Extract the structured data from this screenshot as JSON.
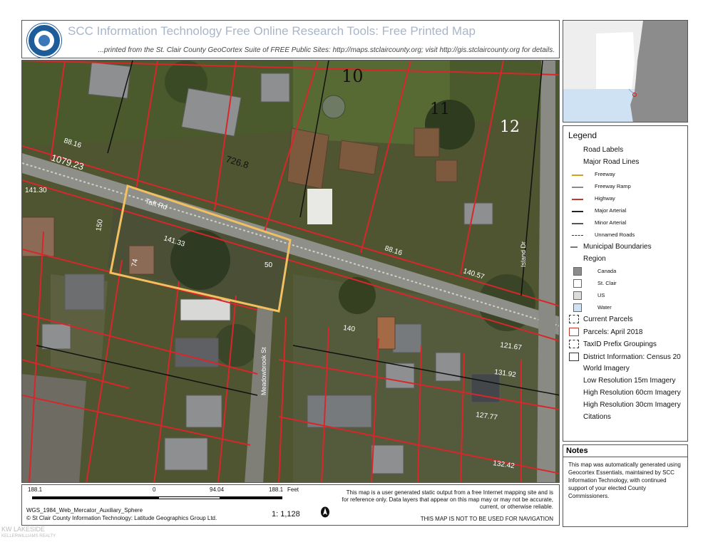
{
  "header": {
    "title": "SCC Information Technology Free Online Research Tools: Free Printed Map",
    "subtitle": "...printed from the St. Clair County GeoCortex Suite of FREE Public Sites: http://maps.stclaircounty.org; visit http://gis.stclaircounty.org for details."
  },
  "map": {
    "road_labels": [
      "Taft Rd",
      "Meadowbrook St",
      "Island Dr"
    ],
    "lot_numbers": [
      "10",
      "11",
      "12"
    ],
    "dimensions": [
      "88.16",
      "1079.23",
      "726.8",
      "141.30",
      "141.33",
      "88.16",
      "140.57",
      "140",
      "121.67",
      "131.92",
      "127.77",
      "132.42",
      "150",
      "74",
      "50"
    ]
  },
  "legend": {
    "title": "Legend",
    "items": [
      {
        "label": "Road Labels",
        "symbol": "none"
      },
      {
        "label": "Major Road Lines",
        "symbol": "none"
      },
      {
        "label": "Freeway",
        "symbol": "line",
        "color": "#d4a017",
        "sub": true
      },
      {
        "label": "Freeway Ramp",
        "symbol": "line",
        "color": "#8a8a8a",
        "sub": true
      },
      {
        "label": "Highway",
        "symbol": "line",
        "color": "#c0392b",
        "sub": true
      },
      {
        "label": "Major Arterial",
        "symbol": "line",
        "color": "#222222",
        "sub": true
      },
      {
        "label": "Minor Arterial",
        "symbol": "line",
        "color": "#555555",
        "sub": true
      },
      {
        "label": "Unnamed Roads",
        "symbol": "dash",
        "color": "#333333",
        "sub": true
      },
      {
        "label": "Municipal Boundaries",
        "symbol": "line",
        "color": "#777777"
      },
      {
        "label": "Region",
        "symbol": "none"
      },
      {
        "label": "Canada",
        "symbol": "box",
        "color": "#8c8c8c",
        "sub": true
      },
      {
        "label": "St. Clair",
        "symbol": "box",
        "color": "#ffffff",
        "sub": true
      },
      {
        "label": "US",
        "symbol": "box",
        "color": "#dcdcdc",
        "sub": true
      },
      {
        "label": "Water",
        "symbol": "box",
        "color": "#cfe2f3",
        "sub": true
      },
      {
        "label": "Current Parcels",
        "symbol": "dashbox",
        "color": "#333333"
      },
      {
        "label": "Parcels: April 2018",
        "symbol": "box",
        "color": "#ffffff",
        "border": "#c0392b"
      },
      {
        "label": "TaxID Prefix Groupings",
        "symbol": "dashbox",
        "color": "#333333"
      },
      {
        "label": "District Information: Census 20",
        "symbol": "box",
        "color": "#ffffff",
        "border": "#333333"
      },
      {
        "label": "World Imagery",
        "symbol": "none"
      },
      {
        "label": "Low Resolution 15m Imagery",
        "symbol": "none"
      },
      {
        "label": "High Resolution 60cm Imagery",
        "symbol": "none"
      },
      {
        "label": "High Resolution 30cm Imagery",
        "symbol": "none"
      },
      {
        "label": "Citations",
        "symbol": "none"
      }
    ]
  },
  "notes": {
    "title": "Notes",
    "body": "This map was automatically generated using Geocortex Essentials, maintained by SCC Information Technology, with continued support of your elected County Commissioners."
  },
  "footer": {
    "scale_labels": [
      "188.1",
      "0",
      "94.04",
      "188.1",
      "Feet"
    ],
    "projection": "WGS_1984_Web_Mercator_Auxiliary_Sphere",
    "credit": "© St Clair County Information Technology: Latitude Geographics Group Ltd.",
    "ratio": "1: 1,128",
    "disclaimer": "This map is a user generated static output from a free Internet mapping site and is for reference only. Data layers that appear on this map may or may not be accurate, current, or otherwise reliable.",
    "not_for_nav": "THIS MAP IS NOT TO BE USED FOR NAVIGATION"
  },
  "watermark": {
    "line1": "KW LAKESIDE",
    "line2": "KELLERWILLIAMS REALTY"
  },
  "colors": {
    "parcel_lines": "#d8262b",
    "subject_parcel": "#f2c061",
    "road": "#9a9a96",
    "title": "#a9b6c9",
    "seal": "#1d5c98"
  }
}
